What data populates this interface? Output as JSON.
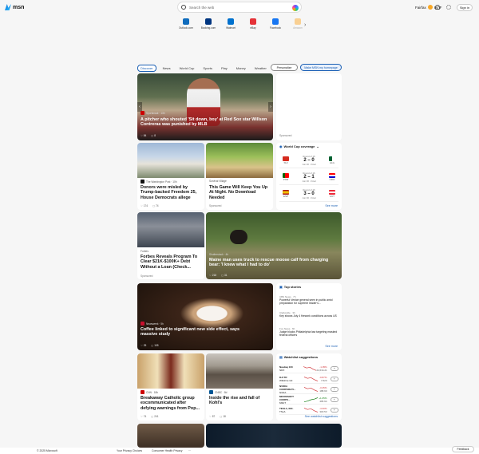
{
  "header": {
    "logo": "msn",
    "search_placeholder": "Search the web",
    "location": "Fairfax",
    "temp": "86°F",
    "signin": "Sign in"
  },
  "shortcuts": [
    {
      "label": "Outlook.com",
      "color": "#0f6cbd"
    },
    {
      "label": "Booking.com",
      "color": "#003580"
    },
    {
      "label": "Walmart",
      "color": "#0071ce"
    },
    {
      "label": "eBay",
      "color": "#e53238"
    },
    {
      "label": "Facebook",
      "color": "#1877f2"
    },
    {
      "label": "Amazon",
      "color": "#ff9900"
    }
  ],
  "nav": {
    "tabs": [
      "Discover",
      "News",
      "World Cup",
      "Sports",
      "Play",
      "Money",
      "Weather",
      "Watch"
    ],
    "more": "···",
    "personalize": "Personalize",
    "homepage": "Make MSN my homepage"
  },
  "hero": {
    "source": "Sportsnaut · 13h",
    "title": "A pitcher who shouted 'Sit down, boy' at Red Sox star Willson Contreras was punished by MLB",
    "likes": "84",
    "comments": "8"
  },
  "ad_top": {
    "sponsored": "Sponsored"
  },
  "card_donors": {
    "source": "The Washington Post · 10h",
    "title": "Donors were misled by Trump-backed Freedom 25, House Democrats allege",
    "likes": "174",
    "comments": "74"
  },
  "card_game": {
    "source": "Survival Village",
    "title": "This Game Will Keep You Up At Night. No Download Needed",
    "sponsored": "Sponsored"
  },
  "worldcup": {
    "title": "World Cup coverage",
    "matches": [
      {
        "stage": "Round of 16",
        "team1": "SUI",
        "team2": "ALG",
        "score": "2 – 0",
        "status": "Jun 30 · Final"
      },
      {
        "stage": "Round of 16",
        "team1": "POR",
        "team2": "CRO",
        "score": "2 – 1",
        "status": "Jun 30 · Final"
      },
      {
        "stage": "Round of 16",
        "team1": "ESP",
        "team2": "AUT",
        "score": "3 – 0",
        "status": "Jun 30 · Final"
      }
    ],
    "link": "See more"
  },
  "card_forbes": {
    "source": "Forbes",
    "title": "Forbes Reveals Program To Clear $21K-$100K+ Debt Without a Loan (Check...",
    "sponsored": "Sponsored"
  },
  "card_moose": {
    "source": "Shutterstock · 4h",
    "title": "Maine man uses truck to rescue moose calf from charging bear: 'I knew what I had to do'",
    "likes": "218",
    "comments": "31"
  },
  "top_stories": {
    "title": "Top stories",
    "items": [
      {
        "source": "CBS News · 7h",
        "text": "Powerful Venice general seen in public amid preparation for supreme leader's..."
      },
      {
        "source": "Clarksville · 3h",
        "text": "Key shows July 4 firework conditions across US"
      },
      {
        "source": "Fox News · 6h",
        "text": "Judge blocks Philadelphia law targeting masked federal officers"
      }
    ],
    "link": "See more"
  },
  "card_coffee": {
    "source": "Newsweek · 5h",
    "title": "Coffee linked to significant new side effect, says massive study",
    "likes": "25",
    "comments": "105"
  },
  "card_catholic": {
    "source": "CNN · 18h",
    "title": "Breakaway Catholic group excommunicated after defying warnings from Pop...",
    "likes": "74",
    "comments": "241"
  },
  "card_kohls": {
    "source": "CNBC · 8d",
    "title": "Inside the rise and fall of Kohl's",
    "likes": "87",
    "comments": "18"
  },
  "watchlist": {
    "title": "Watchlist suggestions",
    "stocks": [
      {
        "name": "Nasdaq 100",
        "sub": "NDX",
        "change": "-1.05%",
        "price": "22,634.21",
        "up": false
      },
      {
        "name": "DJI TR",
        "sub": "Wiltshire GF",
        "change": "-0.87%",
        "price": "7,520",
        "up": false
      },
      {
        "name": "NVIDIA CORPORATI...",
        "sub": "NVDA",
        "change": "-3.45%",
        "price": "188.90",
        "up": false
      },
      {
        "name": "MICROSOFT CORPO...",
        "sub": "MSFT",
        "change": "+1.05%",
        "price": "495.94",
        "up": true
      },
      {
        "name": "TESLA, INC.",
        "sub": "TSLA",
        "change": "-4.30%",
        "price": "318.53",
        "up": false
      }
    ],
    "link": "See watchlist suggestions"
  },
  "footer": {
    "copyright": "© 2025 Microsoft",
    "privacy": "Your Privacy Choices",
    "health": "Consumer Health Privacy",
    "more": "···",
    "feedback": "Feedback"
  }
}
